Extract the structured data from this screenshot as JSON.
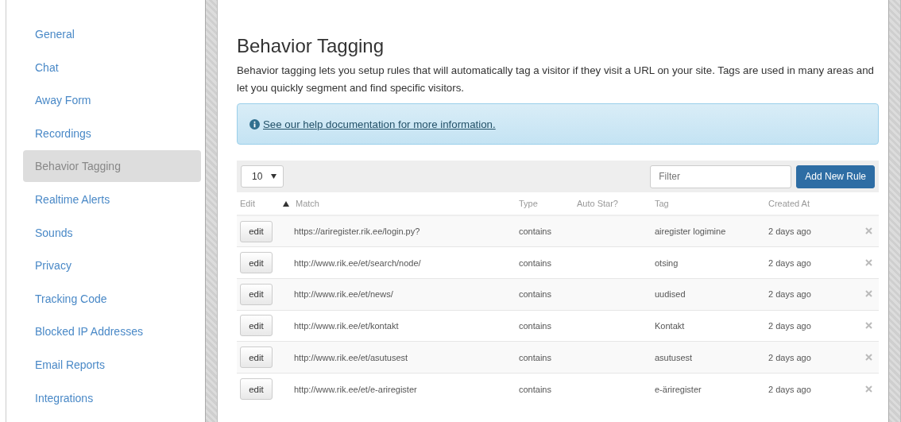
{
  "sidebar": {
    "items": [
      {
        "label": "General",
        "selected": false
      },
      {
        "label": "Chat",
        "selected": false
      },
      {
        "label": "Away Form",
        "selected": false
      },
      {
        "label": "Recordings",
        "selected": false
      },
      {
        "label": "Behavior Tagging",
        "selected": true
      },
      {
        "label": "Realtime Alerts",
        "selected": false
      },
      {
        "label": "Sounds",
        "selected": false
      },
      {
        "label": "Privacy",
        "selected": false
      },
      {
        "label": "Tracking Code",
        "selected": false
      },
      {
        "label": "Blocked IP Addresses",
        "selected": false
      },
      {
        "label": "Email Reports",
        "selected": false
      },
      {
        "label": "Integrations",
        "selected": false
      }
    ]
  },
  "page": {
    "title": "Behavior Tagging",
    "description": "Behavior tagging lets you setup rules that will automatically tag a visitor if they visit a URL on your site. Tags are used in many areas and let you quickly segment and find specific visitors.",
    "help_link": "See our help documentation for more information."
  },
  "toolbar": {
    "page_size": "10",
    "filter_placeholder": "Filter",
    "add_button": "Add New Rule"
  },
  "table": {
    "columns": [
      "Edit",
      "Match",
      "Type",
      "Auto Star?",
      "Tag",
      "Created At"
    ],
    "rows": [
      {
        "edit": "edit",
        "match": "https://ariregister.rik.ee/login.py?",
        "type": "contains",
        "tag": "airegister logimine",
        "created": "2 days ago"
      },
      {
        "edit": "edit",
        "match": "http://www.rik.ee/et/search/node/",
        "type": "contains",
        "tag": "otsing",
        "created": "2 days ago"
      },
      {
        "edit": "edit",
        "match": "http://www.rik.ee/et/news/",
        "type": "contains",
        "tag": "uudised",
        "created": "2 days ago"
      },
      {
        "edit": "edit",
        "match": "http://www.rik.ee/et/kontakt",
        "type": "contains",
        "tag": "Kontakt",
        "created": "2 days ago"
      },
      {
        "edit": "edit",
        "match": "http://www.rik.ee/et/asutusest",
        "type": "contains",
        "tag": "asutusest",
        "created": "2 days ago"
      },
      {
        "edit": "edit",
        "match": "http://www.rik.ee/et/e-ariregister",
        "type": "contains",
        "tag": "e-äriregister",
        "created": "2 days ago"
      }
    ]
  }
}
